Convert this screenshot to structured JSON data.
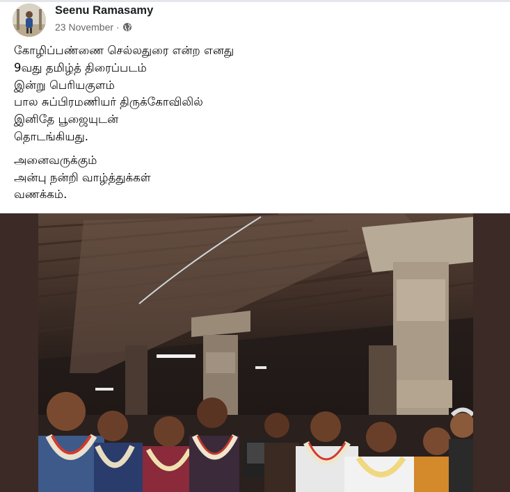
{
  "post": {
    "author": "Seenu Ramasamy",
    "date": "23 November",
    "separator": "·",
    "privacy_icon": "globe-icon",
    "text_lines": [
      "கோழிப்பண்ணை செல்லதுரை என்ற எனது",
      "9வது தமிழ்த் திரைப்படம்",
      "இன்று பெரியகுளம்",
      "பால சுப்பிரமணியர் திருக்கோவிலில்",
      "இனிதே பூஜையுடன்",
      "தொடங்கியது.",
      "அனைவருக்கும்",
      "அன்பு நன்றி வாழ்த்துக்கள்",
      "வணக்கம்."
    ]
  },
  "colors": {
    "name": "#1c1e21",
    "meta": "#65676b",
    "text": "#050505",
    "photo_frame": "#3a2a24"
  }
}
